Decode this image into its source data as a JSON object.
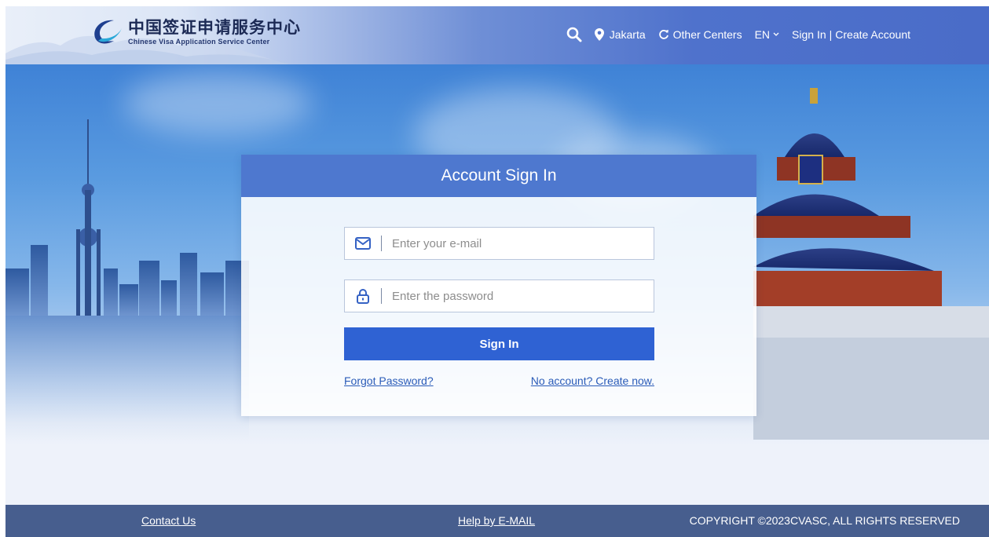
{
  "header": {
    "logo_cn": "中国签证申请服务中心",
    "logo_en": "Chinese Visa Application Service Center",
    "search_icon": "search-icon",
    "location": "Jakarta",
    "other_centers": "Other Centers",
    "language": "EN",
    "sign_in": "Sign In",
    "separator": "|",
    "create_account": "Create Account"
  },
  "login": {
    "title": "Account Sign In",
    "email_placeholder": "Enter your e-mail",
    "password_placeholder": "Enter the password",
    "submit_label": "Sign In",
    "forgot_label": "Forgot Password?",
    "create_label": "No account? Create now."
  },
  "footer": {
    "contact": "Contact Us",
    "help": "Help by E-MAIL",
    "copyright": "COPYRIGHT ©2023CVASC, ALL RIGHTS RESERVED"
  },
  "colors": {
    "header_blue": "#4a6cc8",
    "card_head": "#4e78cf",
    "primary_button": "#2f62d3",
    "footer": "#475e8e",
    "link": "#2a5bb8"
  }
}
